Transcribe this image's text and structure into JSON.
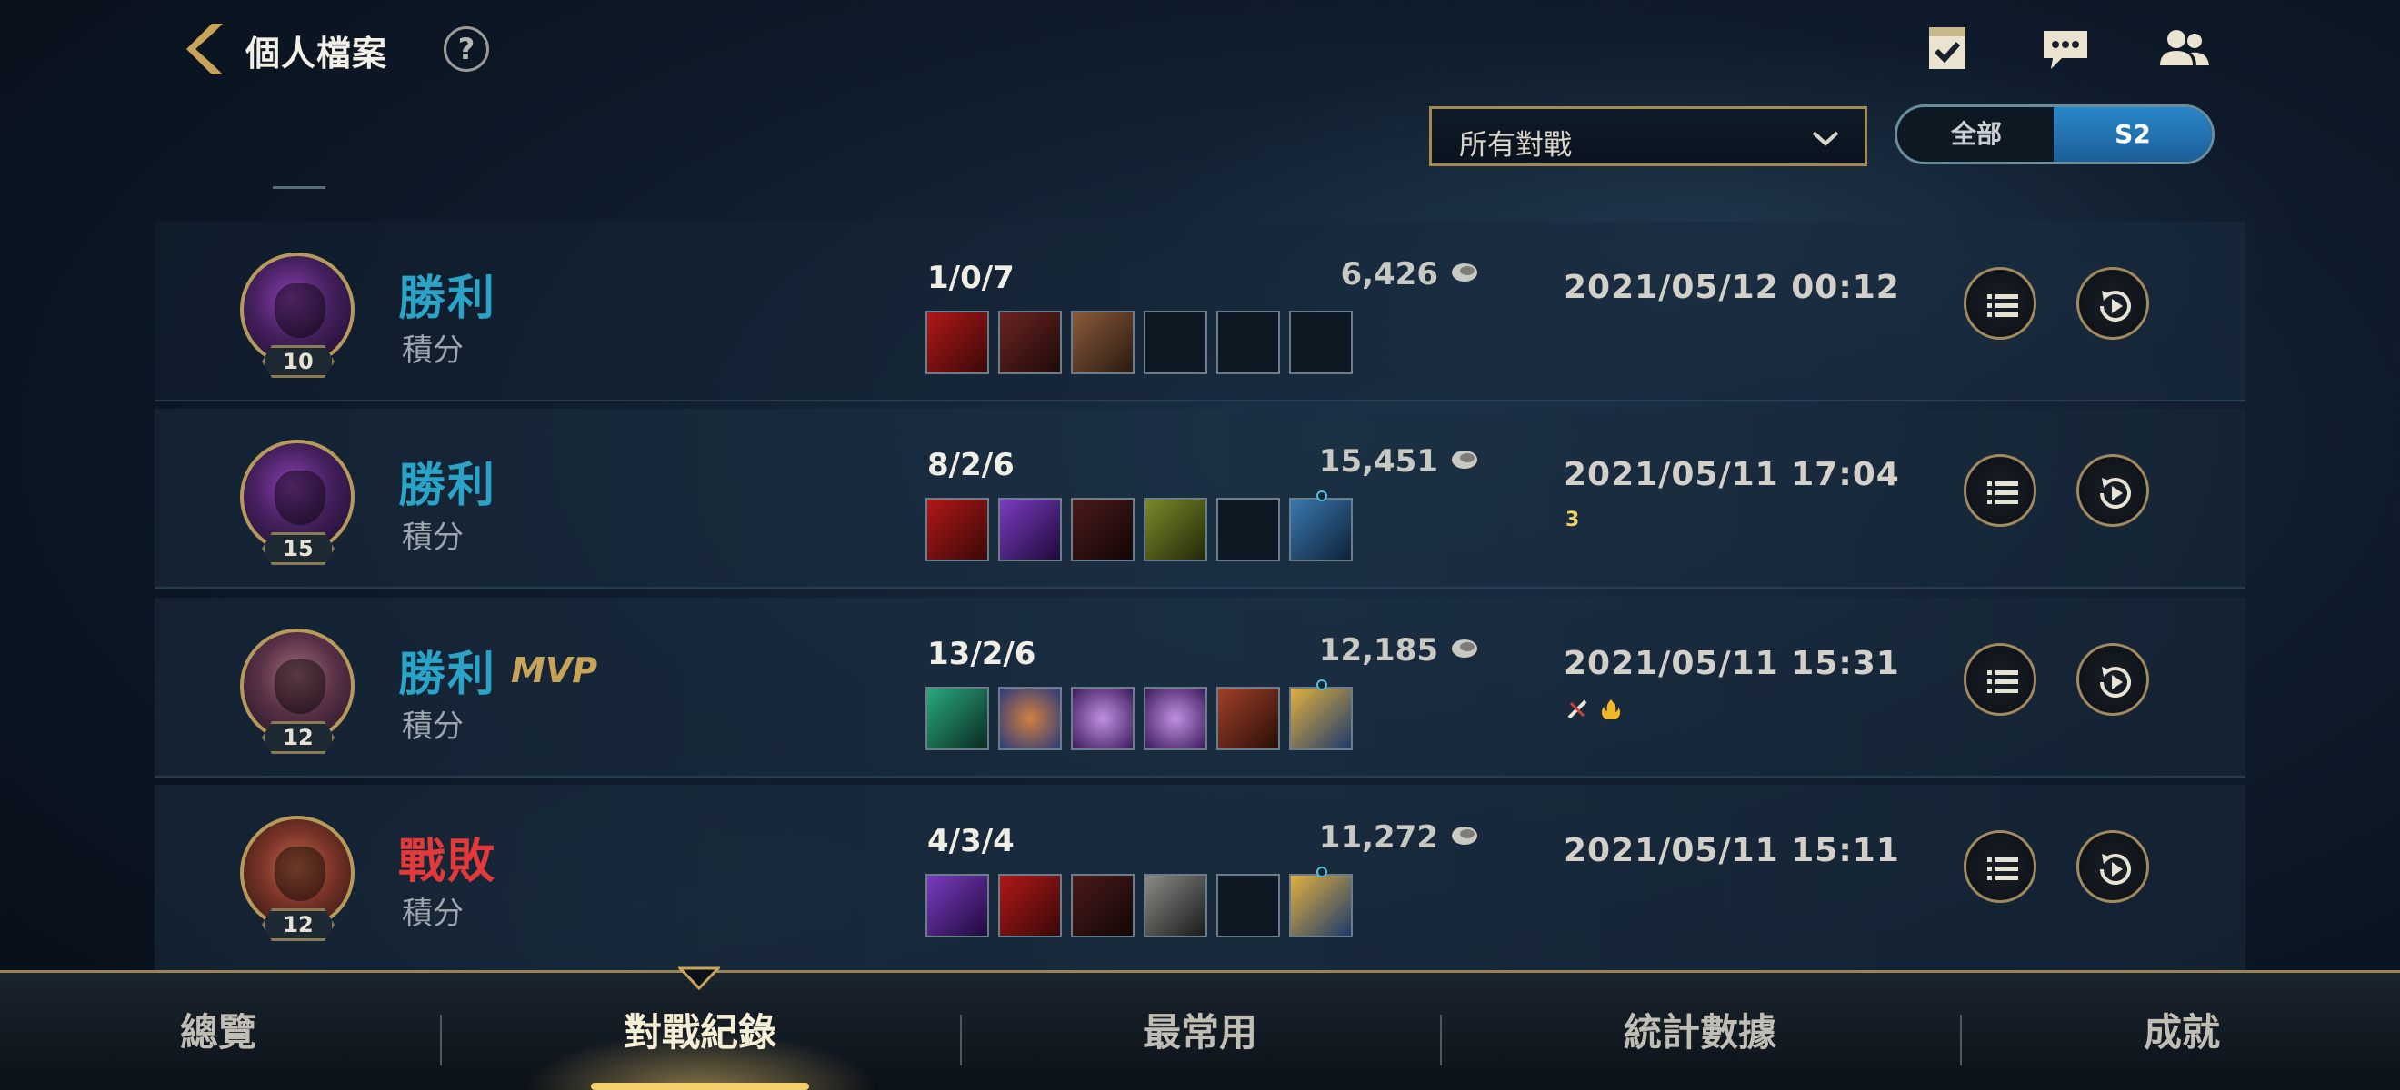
{
  "header": {
    "title": "個人檔案",
    "help_label": "?"
  },
  "filters": {
    "match_type_value": "所有對戰",
    "season_options": [
      "全部",
      "S2"
    ],
    "season_selected": "S2"
  },
  "matches": [
    {
      "champion_level": "10",
      "result": "勝利",
      "outcome": "win",
      "mvp": "",
      "mode": "積分",
      "kda": "1/0/7",
      "gold": "6,426",
      "date": "2021/05/12 00:12",
      "badges": []
    },
    {
      "champion_level": "15",
      "result": "勝利",
      "outcome": "win",
      "mvp": "",
      "mode": "積分",
      "kda": "8/2/6",
      "gold": "15,451",
      "date": "2021/05/11 17:04",
      "badges": [
        "3"
      ]
    },
    {
      "champion_level": "12",
      "result": "勝利",
      "outcome": "win",
      "mvp": "MVP",
      "mode": "積分",
      "kda": "13/2/6",
      "gold": "12,185",
      "date": "2021/05/11 15:31",
      "badges": [
        "sword-icon",
        "flame-icon"
      ]
    },
    {
      "champion_level": "12",
      "result": "戰敗",
      "outcome": "loss",
      "mvp": "",
      "mode": "積分",
      "kda": "4/3/4",
      "gold": "11,272",
      "date": "2021/05/11 15:11",
      "badges": []
    }
  ],
  "bottom_nav": {
    "tabs": [
      "總覽",
      "對戰紀錄",
      "最常用",
      "統計數據",
      "成就"
    ],
    "active": "對戰紀錄"
  },
  "colors": {
    "win": "#2ba3c7",
    "loss": "#e23a3a",
    "accent_gold": "#a48a4f",
    "toggle_active": "#1b5f98"
  },
  "icons": {
    "back": "chevron-left-icon",
    "help": "question-circle-icon",
    "missions": "clipboard-check-icon",
    "chat": "chat-bubble-icon",
    "friends": "friends-icon",
    "details": "list-icon",
    "replay": "replay-icon",
    "gold": "coin-icon"
  }
}
